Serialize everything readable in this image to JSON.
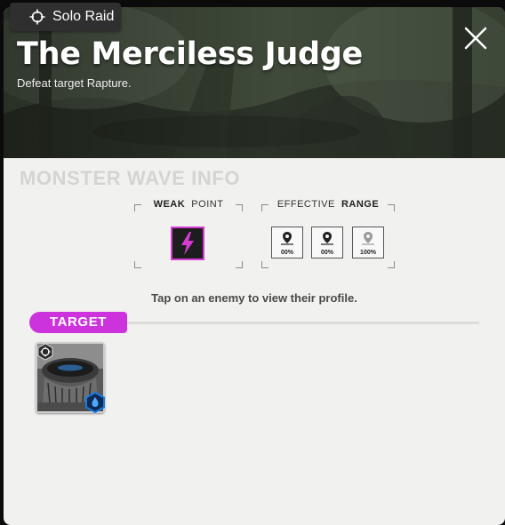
{
  "mode_badge": {
    "label": "Solo Raid",
    "icon": "crosshair-icon"
  },
  "header": {
    "title": "The Merciless Judge",
    "subtitle": "Defeat target Rapture.",
    "close_icon": "close-icon"
  },
  "section_title": "MONSTER WAVE INFO",
  "weak_point": {
    "label_a": "WEAK",
    "label_b": "POINT",
    "icon": "lightning-icon",
    "color": "#d63cd4"
  },
  "effective_range": {
    "label_a": "EFFECTIVE",
    "label_b": "RANGE",
    "items": [
      {
        "icon": "location-pin-icon",
        "value": "00%"
      },
      {
        "icon": "location-pin-icon",
        "value": "00%"
      },
      {
        "icon": "location-pin-icon",
        "value": "100%"
      }
    ]
  },
  "hint": "Tap on an enemy to view their profile.",
  "target": {
    "label": "TARGET",
    "color": "#cc33dd"
  },
  "enemies": [
    {
      "name_icon": "rapture-portrait",
      "type_icon": "rapture-type-icon",
      "element_icon": "water-element-icon",
      "element_color": "#1a7be0"
    }
  ]
}
